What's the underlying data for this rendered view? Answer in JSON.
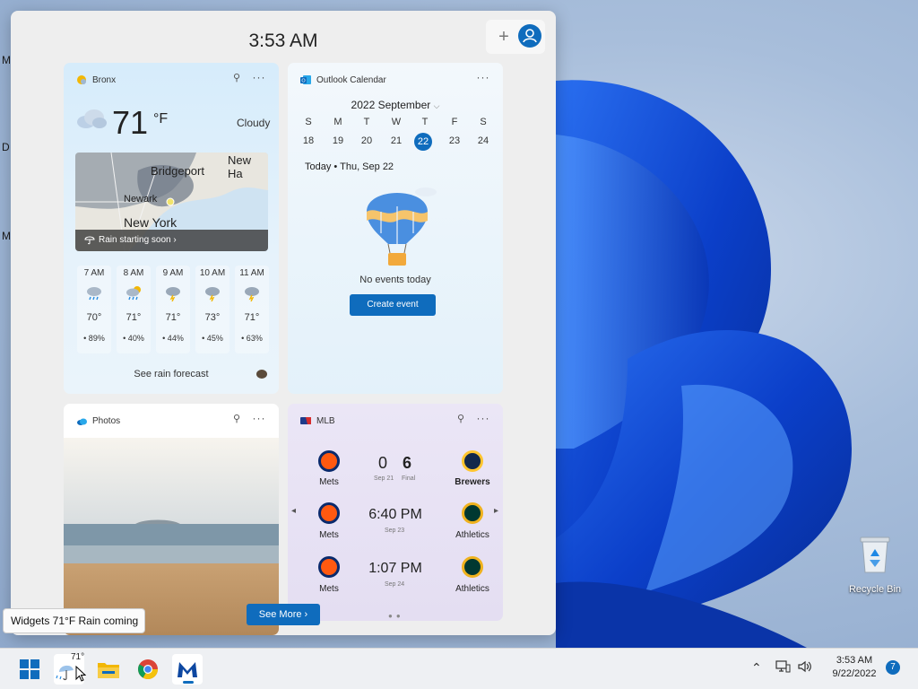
{
  "desktop": {
    "edge_letters": [
      "M",
      "D",
      "M"
    ],
    "recycle_bin_label": "Recycle Bin"
  },
  "board": {
    "time": "3:53 AM",
    "add_glyph": "+"
  },
  "weather": {
    "location": "Bronx",
    "temp": "71",
    "unit": "°F",
    "condition": "Cloudy",
    "map_labels": [
      "Bridgeport",
      "New Ha",
      "Newark",
      "New York"
    ],
    "rain_banner": "Rain starting soon ›",
    "hours": [
      {
        "time": "7 AM",
        "temp": "70°",
        "rain": "89%"
      },
      {
        "time": "8 AM",
        "temp": "71°",
        "rain": "40%"
      },
      {
        "time": "9 AM",
        "temp": "71°",
        "rain": "44%"
      },
      {
        "time": "10 AM",
        "temp": "73°",
        "rain": "45%"
      },
      {
        "time": "11 AM",
        "temp": "71°",
        "rain": "63%"
      }
    ],
    "forecast_link": "See rain forecast"
  },
  "calendar": {
    "title": "Outlook Calendar",
    "month": "2022 September",
    "weekdays": [
      "S",
      "M",
      "T",
      "W",
      "T",
      "F",
      "S"
    ],
    "dates": [
      "18",
      "19",
      "20",
      "21",
      "22",
      "23",
      "24"
    ],
    "today_index": 4,
    "today_line": "Today • Thu, Sep 22",
    "no_events": "No events today",
    "create_button": "Create event"
  },
  "photos": {
    "title": "Photos"
  },
  "mlb": {
    "title": "MLB",
    "games": [
      {
        "home": "Mets",
        "away": "Brewers",
        "score_home": "0",
        "score_away": "6",
        "date": "Sep 21",
        "status": "Final"
      },
      {
        "home": "Mets",
        "away": "Athletics",
        "time": "6:40 PM",
        "date": "Sep 23"
      },
      {
        "home": "Mets",
        "away": "Athletics",
        "time": "1:07 PM",
        "date": "Sep 24"
      }
    ]
  },
  "see_more": "See More ›",
  "tooltip": "Widgets 71°F Rain coming",
  "taskbar": {
    "weather_temp": "71°",
    "time": "3:53 AM",
    "date": "9/22/2022",
    "notifications": "7"
  },
  "colors": {
    "accent": "#0f6cbd",
    "mets": "#ff5910",
    "brewers": "#12284b",
    "athletics": "#003831"
  }
}
